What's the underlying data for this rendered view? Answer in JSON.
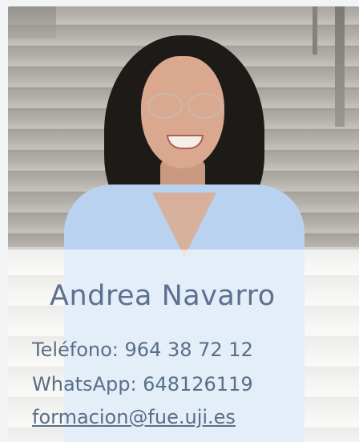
{
  "contact_card": {
    "name": "Andrea Navarro",
    "phone": "Teléfono: 964 38 72 12",
    "whatsapp": "WhatsApp: 648126119",
    "email": "formacion@fue.uji.es"
  },
  "colors": {
    "name_text": "#5c7190",
    "info_text": "#5a6e86",
    "overlay": "rgba(255,255,255,0.62)"
  }
}
